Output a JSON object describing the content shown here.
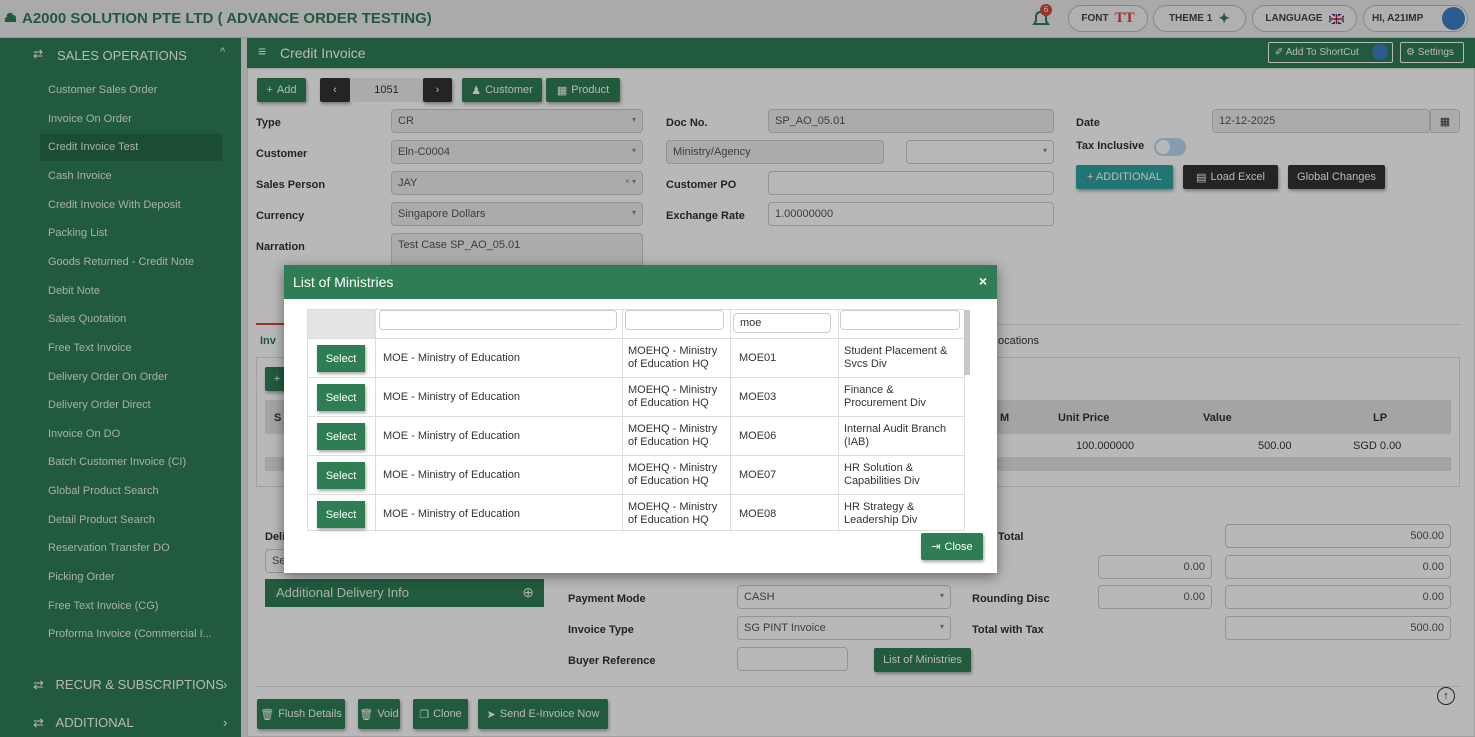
{
  "topbar": {
    "company": "A2000 SOLUTION PTE LTD ( ADVANCE ORDER TESTING)",
    "notif_count": "6",
    "font_label": "FONT",
    "theme_label": "THEME 1",
    "language_label": "LANGUAGE",
    "user_label": "HI, A21IMP"
  },
  "sidebar": {
    "section": "SALES OPERATIONS",
    "items": [
      "Customer Sales Order",
      "Invoice On Order",
      "Credit Invoice Test",
      "Cash Invoice",
      "Credit Invoice With Deposit",
      "Packing List",
      "Goods Returned - Credit Note",
      "Debit Note",
      "Sales Quotation",
      "Free Text Invoice",
      "Delivery Order On Order",
      "Delivery Order Direct",
      "Invoice On DO",
      "Batch Customer Invoice (CI)",
      "Global Product Search",
      "Detail Product Search",
      "Reservation Transfer DO",
      "Picking Order",
      "Free Text Invoice (CG)",
      "Proforma Invoice (Commercial I..."
    ],
    "groups": [
      "RECUR & SUBSCRIPTIONS",
      "ADDITIONAL"
    ]
  },
  "header": {
    "title": "Credit Invoice",
    "shortcut_label": "Add To ShortCut",
    "settings_label": "Settings"
  },
  "toolbar": {
    "add": "Add",
    "record_no": "1051",
    "customer": "Customer",
    "product": "Product"
  },
  "form": {
    "type_label": "Type",
    "type_value": "CR",
    "customer_label": "Customer",
    "customer_value": "Eln-C0004",
    "salesperson_label": "Sales Person",
    "salesperson_value": "JAY",
    "currency_label": "Currency",
    "currency_value": "Singapore Dollars",
    "narration_label": "Narration",
    "narration_value": "Test Case SP_AO_05.01",
    "docno_label": "Doc No.",
    "docno_value": "SP_AO_05.01",
    "ministry_placeholder": "Ministry/Agency",
    "customerpo_label": "Customer PO",
    "exrate_label": "Exchange Rate",
    "exrate_value": "1.00000000",
    "date_label": "Date",
    "date_value": "12-12-2025",
    "taxinc_label": "Tax Inclusive",
    "additional_btn": "+ ADDITIONAL",
    "loadexcel_btn": "Load Excel",
    "global_btn": "Global Changes"
  },
  "tabs": {
    "first": "Inv",
    "allocations": "ocations"
  },
  "grid": {
    "col_uom": "M",
    "col_unitprice": "Unit Price",
    "col_value": "Value",
    "col_lp": "LP",
    "unitprice": "100.000000",
    "value": "500.00",
    "lp": "SGD 0.00",
    "s_col": "S"
  },
  "bottom": {
    "deli": "Deli",
    "se": "Se",
    "add_delivery": "Additional Delivery Info",
    "paymode_label": "Payment Mode",
    "paymode_value": "CASH",
    "invtype_label": "Invoice Type",
    "invtype_value": "SG PINT Invoice",
    "buyerref_label": "Buyer Reference",
    "ministries_btn": "List of Ministries",
    "total_label": "Total",
    "total_value": "500.00",
    "row2_a": "0.00",
    "row2_b": "0.00",
    "rounding_label": "Rounding Disc",
    "rounding_a": "0.00",
    "rounding_b": "0.00",
    "totaltax_label": "Total with Tax",
    "totaltax_value": "500.00"
  },
  "footer": {
    "flush": "Flush Details",
    "void": "Void",
    "clone": "Clone",
    "send": "Send E-Invoice Now"
  },
  "modal": {
    "title": "List of Ministries",
    "close_x": "×",
    "filter_value": "moe",
    "select_label": "Select",
    "close_label": "Close",
    "rows": [
      {
        "ministry": "MOE - Ministry of Education",
        "hq": "MOEHQ - Ministry of Education HQ",
        "code": "MOE01",
        "div": "Student Placement & Svcs Div"
      },
      {
        "ministry": "MOE - Ministry of Education",
        "hq": "MOEHQ - Ministry of Education HQ",
        "code": "MOE03",
        "div": "Finance & Procurement Div"
      },
      {
        "ministry": "MOE - Ministry of Education",
        "hq": "MOEHQ - Ministry of Education HQ",
        "code": "MOE06",
        "div": "Internal Audit Branch (IAB)"
      },
      {
        "ministry": "MOE - Ministry of Education",
        "hq": "MOEHQ - Ministry of Education HQ",
        "code": "MOE07",
        "div": "HR Solution & Capabilities Div"
      },
      {
        "ministry": "MOE - Ministry of Education",
        "hq": "MOEHQ - Ministry of Education HQ",
        "code": "MOE08",
        "div": "HR Strategy & Leadership Div"
      }
    ]
  },
  "colors": {
    "brand": "#2e7d55",
    "teal": "#2ea3a0",
    "dark": "#333333"
  }
}
